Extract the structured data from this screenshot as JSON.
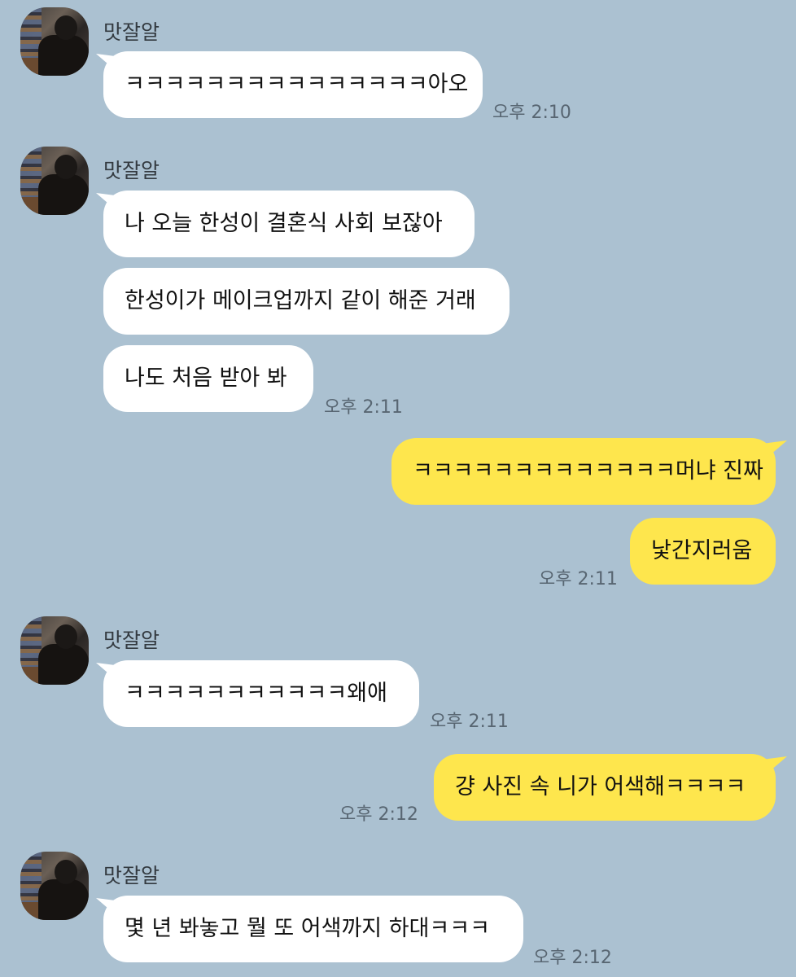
{
  "chat": {
    "messages": [
      {
        "sender": "맛잘알",
        "direction": "incoming",
        "text": "ㅋㅋㅋㅋㅋㅋㅋㅋㅋㅋㅋㅋㅋㅋㅋ아오",
        "time": "오후 2:10"
      },
      {
        "sender": "맛잘알",
        "direction": "incoming",
        "text": "나 오늘 한성이 결혼식 사회 보잖아"
      },
      {
        "direction": "incoming",
        "text": "한성이가 메이크업까지 같이 해준 거래"
      },
      {
        "direction": "incoming",
        "text": "나도 처음 받아 봐",
        "time": "오후 2:11"
      },
      {
        "direction": "outgoing",
        "text": "ㅋㅋㅋㅋㅋㅋㅋㅋㅋㅋㅋㅋㅋ머냐 진짜"
      },
      {
        "direction": "outgoing",
        "text": "낯간지러움",
        "time": "오후 2:11"
      },
      {
        "sender": "맛잘알",
        "direction": "incoming",
        "text": "ㅋㅋㅋㅋㅋㅋㅋㅋㅋㅋㅋ왜애",
        "time": "오후 2:11"
      },
      {
        "direction": "outgoing",
        "text": "걍 사진 속 니가 어색해ㅋㅋㅋㅋ",
        "time": "오후 2:12"
      },
      {
        "sender": "맛잘알",
        "direction": "incoming",
        "text": "몇 년 봐놓고 뭘 또 어색까지 하대ㅋㅋㅋ",
        "time": "오후 2:12"
      }
    ]
  },
  "colors": {
    "background": "#abc1d1",
    "incoming_bubble": "#ffffff",
    "outgoing_bubble": "#fee64d"
  },
  "icons": {
    "avatar": "profile-photo"
  }
}
